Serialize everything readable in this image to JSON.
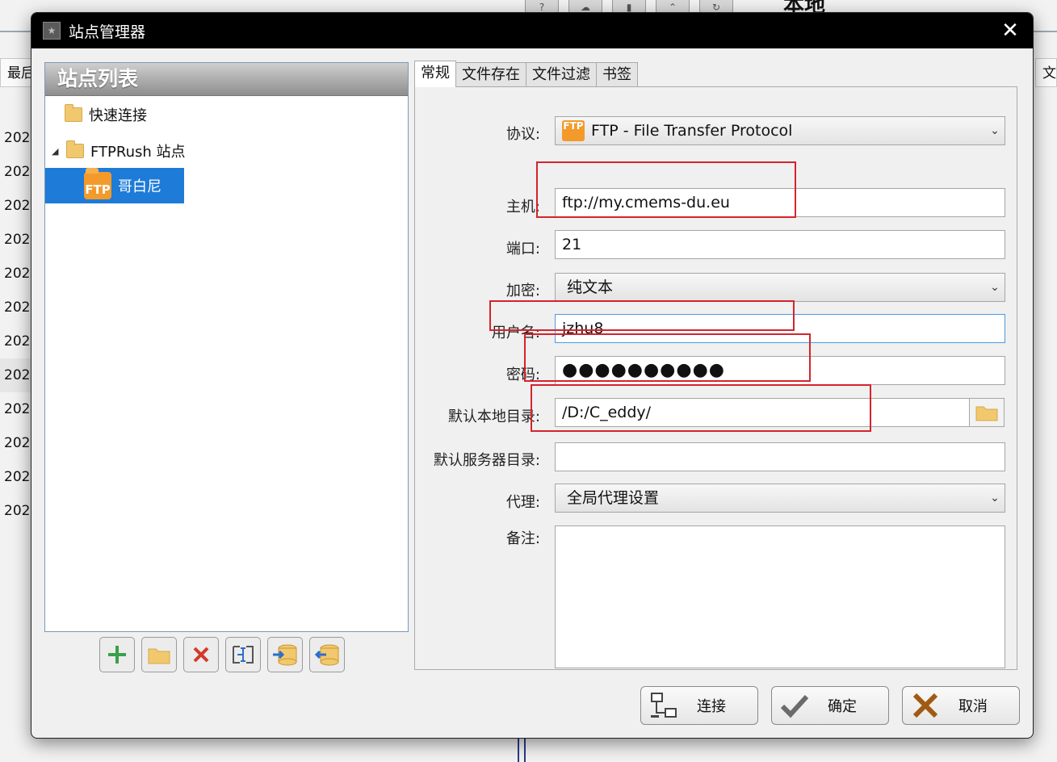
{
  "background": {
    "local_label": "本地",
    "left_header": "最后",
    "right_header": "文",
    "row_year": "202",
    "row_count": 12
  },
  "dialog": {
    "title": "站点管理器",
    "close_glyph": "✕"
  },
  "site_list": {
    "header": "站点列表",
    "items": [
      {
        "label": "快速连接"
      },
      {
        "label": "FTPRush 站点"
      },
      {
        "label": "哥白尼",
        "badge": "FTP"
      }
    ]
  },
  "tabs": [
    {
      "label": "常规",
      "active": true
    },
    {
      "label": "文件存在"
    },
    {
      "label": "文件过滤"
    },
    {
      "label": "书签"
    }
  ],
  "form": {
    "protocol_label": "协议:",
    "protocol_value": "FTP - File Transfer Protocol",
    "protocol_badge": "FTP",
    "host_label": "主机:",
    "host_value": "ftp://my.cmems-du.eu",
    "port_label": "端口:",
    "port_value": "21",
    "encryption_label": "加密:",
    "encryption_value": "纯文本",
    "username_label": "用户名:",
    "username_value": "jzhu8",
    "password_label": "密码:",
    "password_value": "●●●●●●●●●●",
    "local_dir_label": "默认本地目录:",
    "local_dir_value": "/D:/C_eddy/",
    "remote_dir_label": "默认服务器目录:",
    "remote_dir_value": "",
    "proxy_label": "代理:",
    "proxy_value": "全局代理设置",
    "notes_label": "备注:",
    "notes_value": ""
  },
  "buttons": {
    "connect": "连接",
    "ok": "确定",
    "cancel": "取消"
  },
  "colors": {
    "selection": "#1e7bd8",
    "highlight_box": "#d4242b",
    "ftp_orange": "#f39a2b",
    "focus_border": "#4f9ae0"
  }
}
